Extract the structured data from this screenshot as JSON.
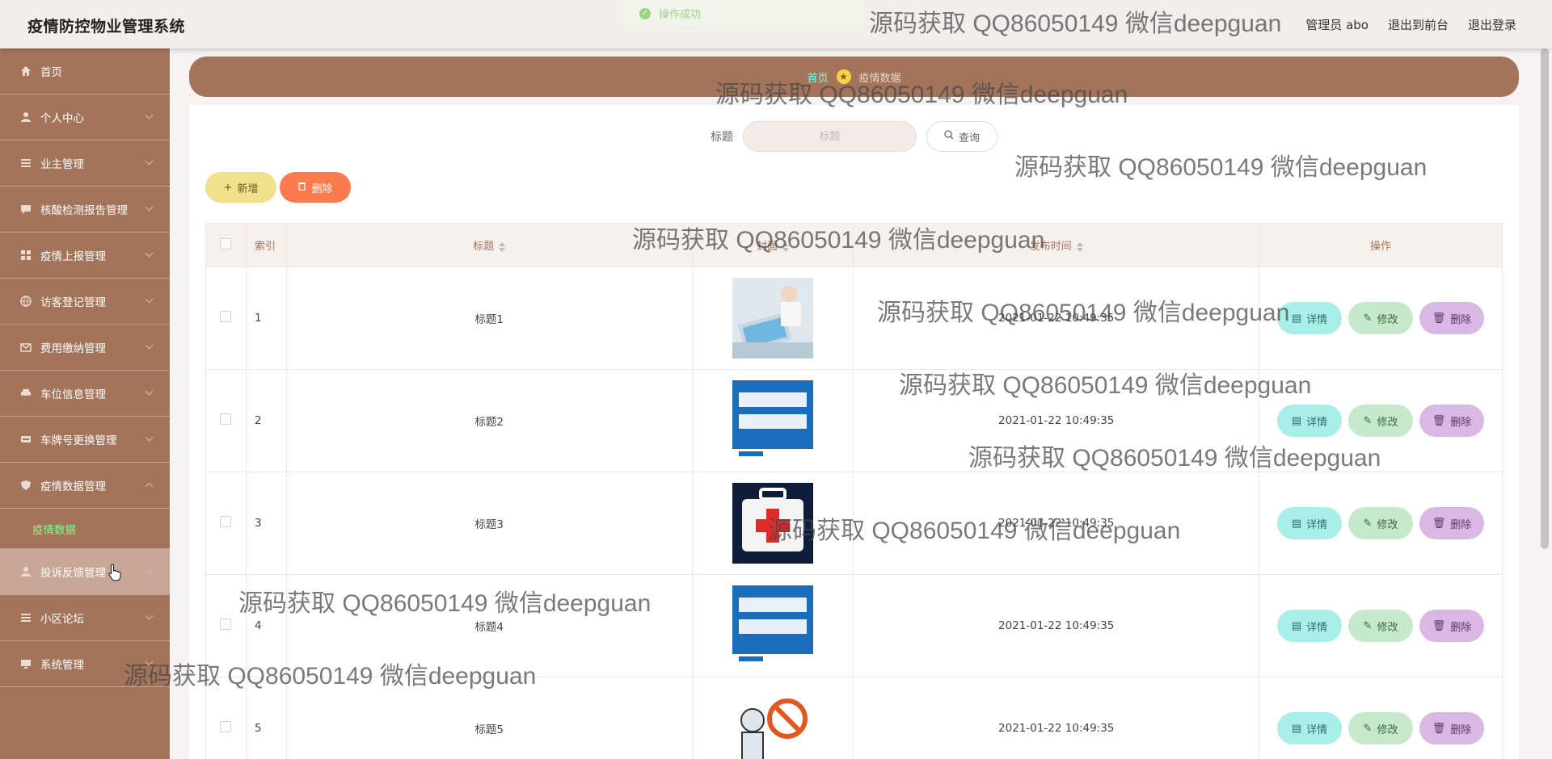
{
  "app": {
    "title": "疫情防控物业管理系统"
  },
  "header": {
    "user_label": "管理员 abo",
    "to_frontend": "退出到前台",
    "logout": "退出登录"
  },
  "toast": {
    "message": "操作成功"
  },
  "sidebar": {
    "items": [
      {
        "label": "首页",
        "icon": "home-icon"
      },
      {
        "label": "个人中心",
        "icon": "user-icon"
      },
      {
        "label": "业主管理",
        "icon": "list-icon"
      },
      {
        "label": "核酸检测报告管理",
        "icon": "chat-icon"
      },
      {
        "label": "疫情上报管理",
        "icon": "grid-icon"
      },
      {
        "label": "访客登记管理",
        "icon": "globe-icon"
      },
      {
        "label": "费用缴纳管理",
        "icon": "mail-icon"
      },
      {
        "label": "车位信息管理",
        "icon": "car-icon"
      },
      {
        "label": "车牌号更换管理",
        "icon": "card-icon"
      },
      {
        "label": "疫情数据管理",
        "icon": "shield-icon"
      },
      {
        "label": "投诉反馈管理",
        "icon": "user-icon"
      },
      {
        "label": "小区论坛",
        "icon": "list-icon"
      },
      {
        "label": "系统管理",
        "icon": "monitor-icon"
      }
    ],
    "sub_item": "疫情数据"
  },
  "breadcrumb": {
    "home": "首页",
    "current": "疫情数据"
  },
  "search": {
    "label": "标题",
    "placeholder": "标题",
    "button": "查询"
  },
  "actions": {
    "add": "新增",
    "delete": "删除"
  },
  "table": {
    "headers": {
      "index": "索引",
      "title": "标题",
      "cover": "封面",
      "time": "发布时间",
      "ops": "操作"
    },
    "rows": [
      {
        "index": "1",
        "title": "标题1",
        "time": "2021-01-22 10:49:35"
      },
      {
        "index": "2",
        "title": "标题2",
        "time": "2021-01-22 10:49:35"
      },
      {
        "index": "3",
        "title": "标题3",
        "time": "2021-01-22 10:49:35"
      },
      {
        "index": "4",
        "title": "标题4",
        "time": "2021-01-22 10:49:35"
      },
      {
        "index": "5",
        "title": "标题5",
        "time": "2021-01-22 10:49:35"
      }
    ],
    "op_detail": "详情",
    "op_edit": "修改",
    "op_delete": "删除"
  },
  "watermark": "源码获取 QQ86050149 微信deepguan",
  "colors": {
    "sidebar": "#a3735a",
    "header": "#f4eeeb",
    "add_button": "#f2e18c",
    "delete_button": "#fb7b4f",
    "detail": "#a9efe9",
    "edit": "#c6e9cc",
    "row_delete": "#d9b8e4"
  }
}
